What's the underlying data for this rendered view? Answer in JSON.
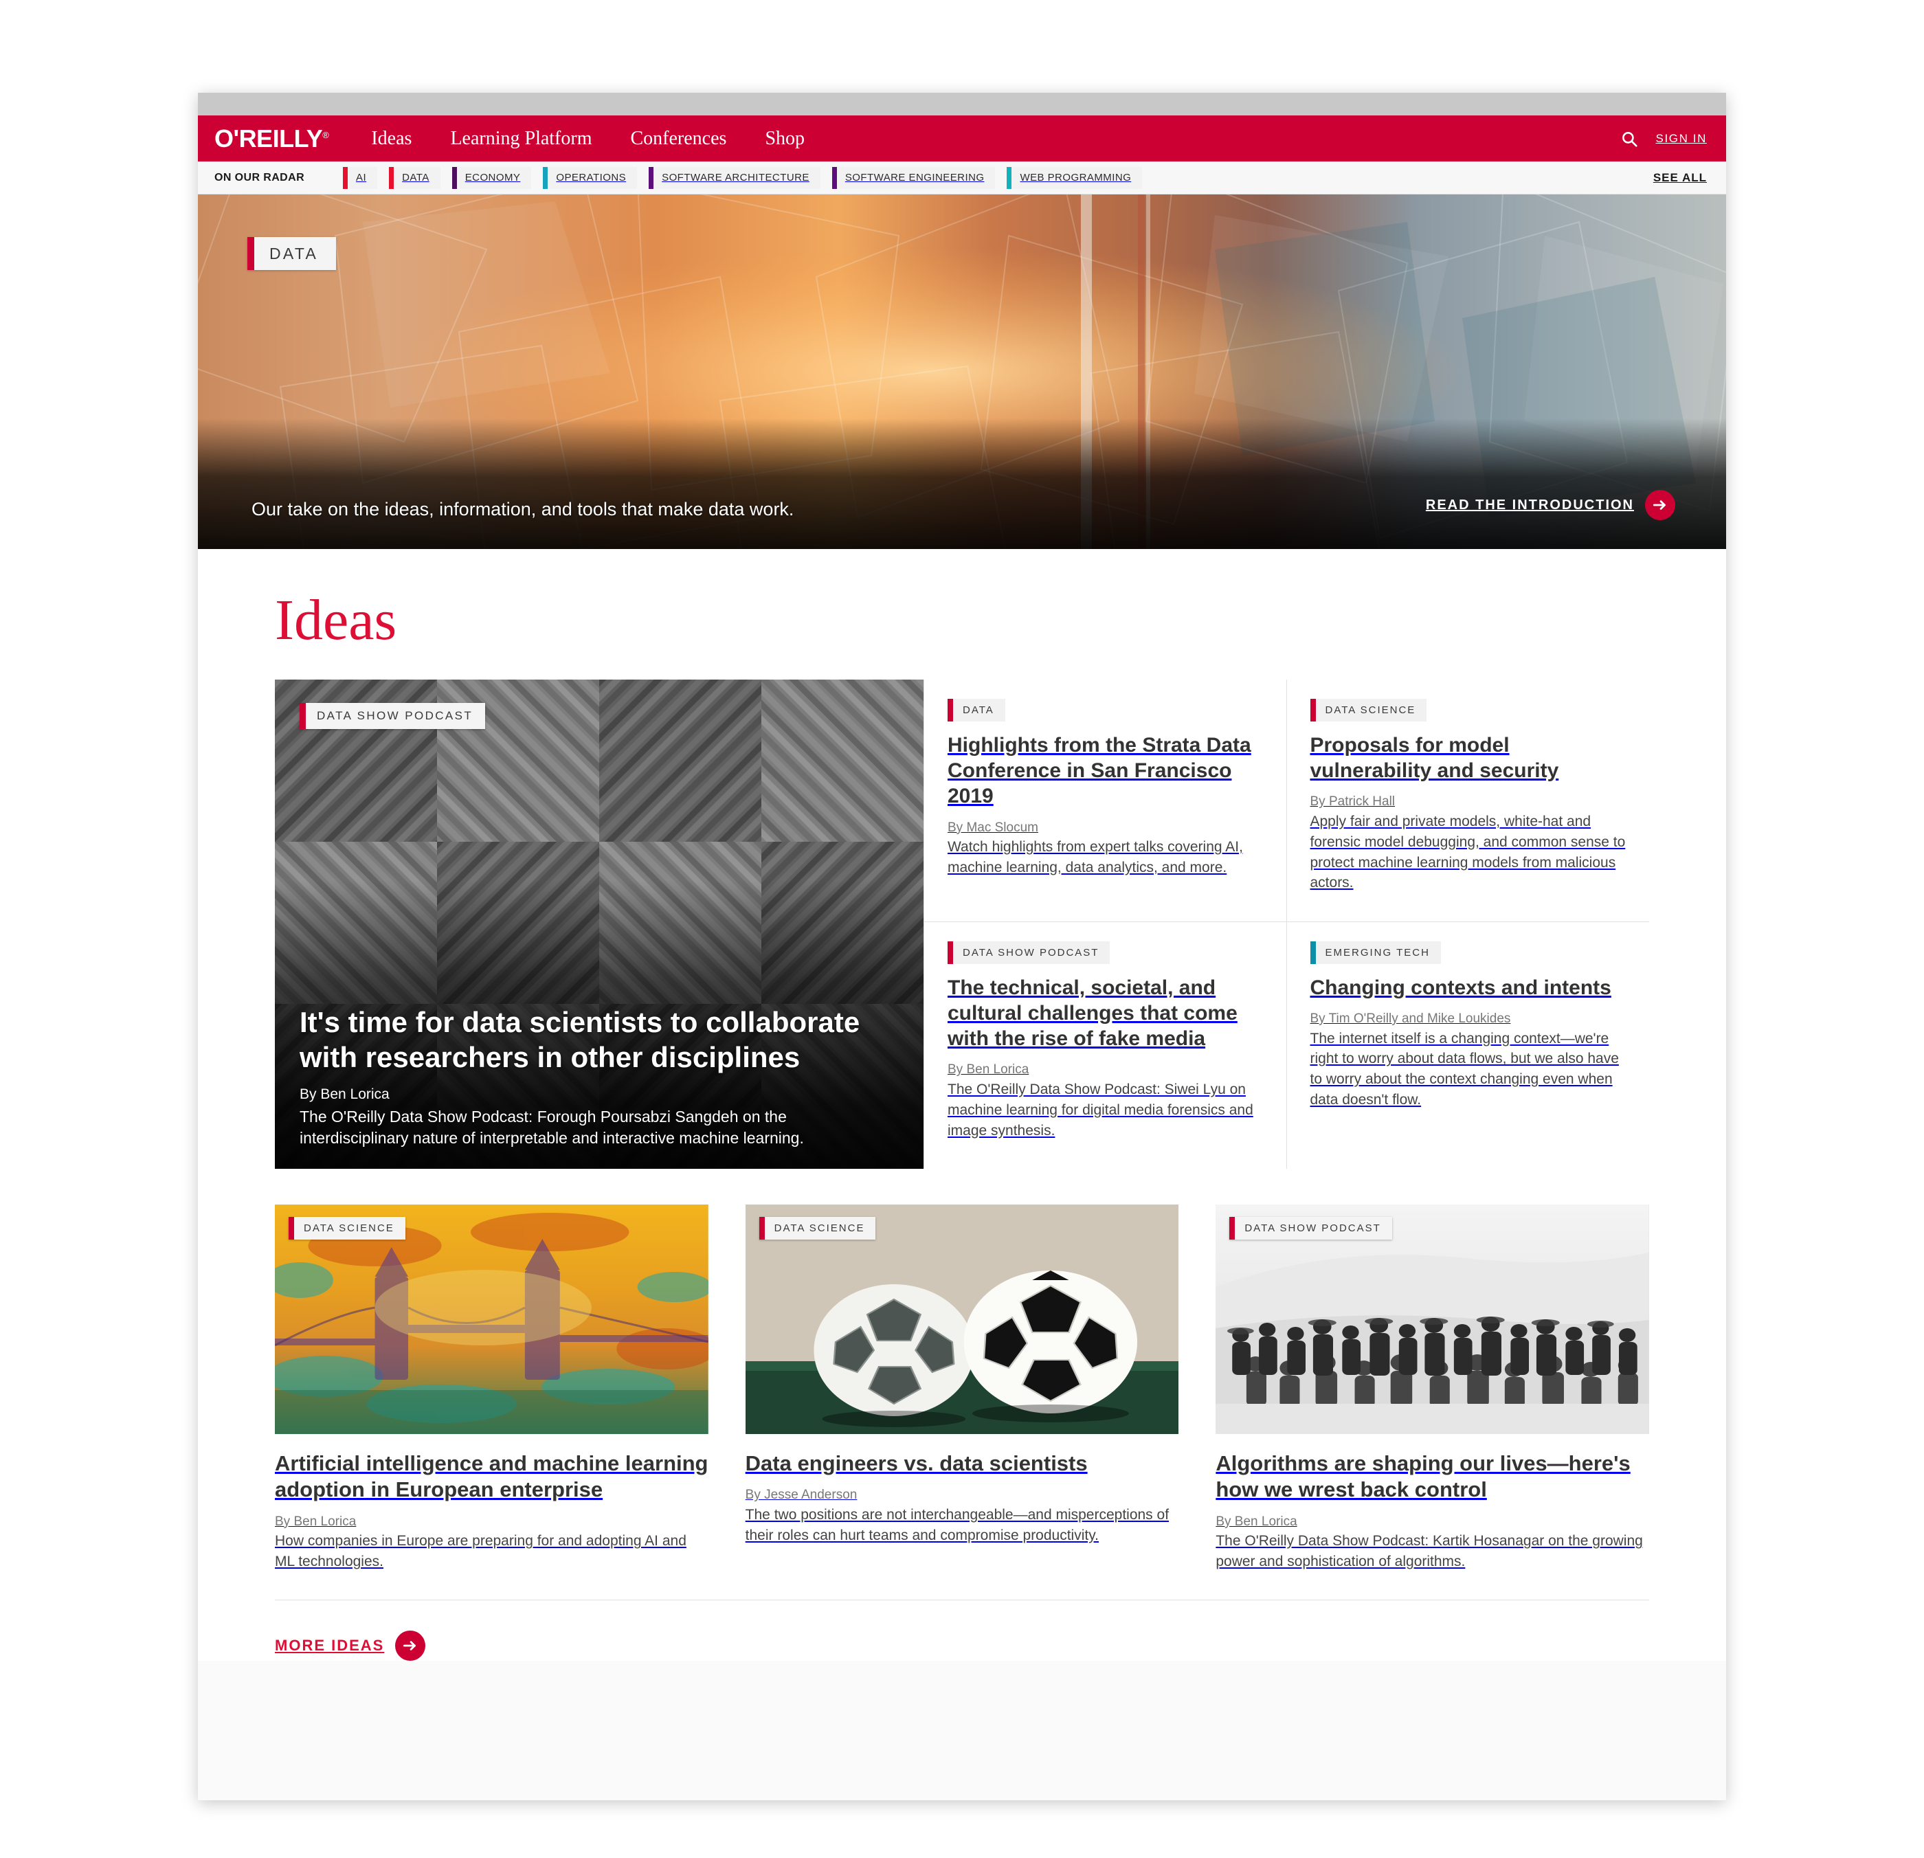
{
  "nav": {
    "logo": "O'REILLY",
    "logo_sup": "®",
    "links": [
      "Ideas",
      "Learning Platform",
      "Conferences",
      "Shop"
    ],
    "search_icon": "search-icon",
    "signin": "SIGN IN"
  },
  "radar": {
    "label": "ON OUR RADAR",
    "see_all": "SEE ALL",
    "items": [
      {
        "label": "AI",
        "color": "#e8112d"
      },
      {
        "label": "DATA",
        "color": "#e8112d"
      },
      {
        "label": "ECONOMY",
        "color": "#4b0f5e"
      },
      {
        "label": "OPERATIONS",
        "color": "#17a3bd"
      },
      {
        "label": "SOFTWARE ARCHITECTURE",
        "color": "#5c0f7b"
      },
      {
        "label": "SOFTWARE ENGINEERING",
        "color": "#5c0f7b"
      },
      {
        "label": "WEB PROGRAMMING",
        "color": "#12b2bd"
      }
    ]
  },
  "hero": {
    "badge": "DATA",
    "tagline": "Our take on the ideas, information, and tools that make data work.",
    "cta": "READ THE INTRODUCTION",
    "cta_icon": "arrow-right-icon"
  },
  "section": {
    "title": "Ideas"
  },
  "feature": {
    "badge": "DATA SHOW PODCAST",
    "badge_color": "#cc0033",
    "title": "It's time for data scientists to collaborate with researchers in other disciplines",
    "author": "By Ben Lorica",
    "desc": "The O'Reilly Data Show Podcast: Forough Poursabzi Sangdeh on the interdisciplinary nature of interpretable and interactive machine learning."
  },
  "quad": [
    {
      "badge": "DATA",
      "badge_color": "#cc0033",
      "title": "Highlights from the Strata Data Conference in San Francisco 2019",
      "author": "By Mac Slocum",
      "desc": "Watch highlights from expert talks covering AI, machine learning, data analytics, and more."
    },
    {
      "badge": "DATA SCIENCE",
      "badge_color": "#cc0033",
      "title": "Proposals for model vulnerability and security",
      "author": "By Patrick Hall",
      "desc": "Apply fair and private models, white-hat and forensic model debugging, and common sense to protect machine learning models from malicious actors."
    },
    {
      "badge": "DATA SHOW PODCAST",
      "badge_color": "#cc0033",
      "title": "The technical, societal, and cultural challenges that come with the rise of fake media",
      "author": "By Ben Lorica",
      "desc": "The O'Reilly Data Show Podcast: Siwei Lyu on machine learning for digital media forensics and image synthesis."
    },
    {
      "badge": "EMERGING TECH",
      "badge_color": "#0d8fa8",
      "title": "Changing contexts and intents",
      "author": "By Tim O'Reilly and Mike Loukides",
      "desc": "The internet itself is a changing context—we're right to worry about data flows, but we also have to worry about the context changing even when data doesn't flow."
    }
  ],
  "bottom": [
    {
      "badge": "DATA SCIENCE",
      "title": "Artificial intelligence and machine learning adoption in European enterprise",
      "author": "By Ben Lorica",
      "desc": "How companies in Europe are preparing for and adopting AI and ML technologies."
    },
    {
      "badge": "DATA SCIENCE",
      "title": "Data engineers vs. data scientists",
      "author": "By Jesse Anderson",
      "desc": "The two positions are not interchangeable—and misperceptions of their roles can hurt teams and compromise productivity."
    },
    {
      "badge": "DATA SHOW PODCAST",
      "title": "Algorithms are shaping our lives—here's how we wrest back control",
      "author": "By Ben Lorica",
      "desc": "The O'Reilly Data Show Podcast: Kartik Hosanagar on the growing power and sophistication of algorithms."
    }
  ],
  "more_ideas": {
    "label": "MORE IDEAS",
    "icon": "arrow-right-icon"
  },
  "colors": {
    "brand_red": "#cc0033",
    "accent_red": "#dd0f35",
    "teal": "#0d8fa8"
  }
}
